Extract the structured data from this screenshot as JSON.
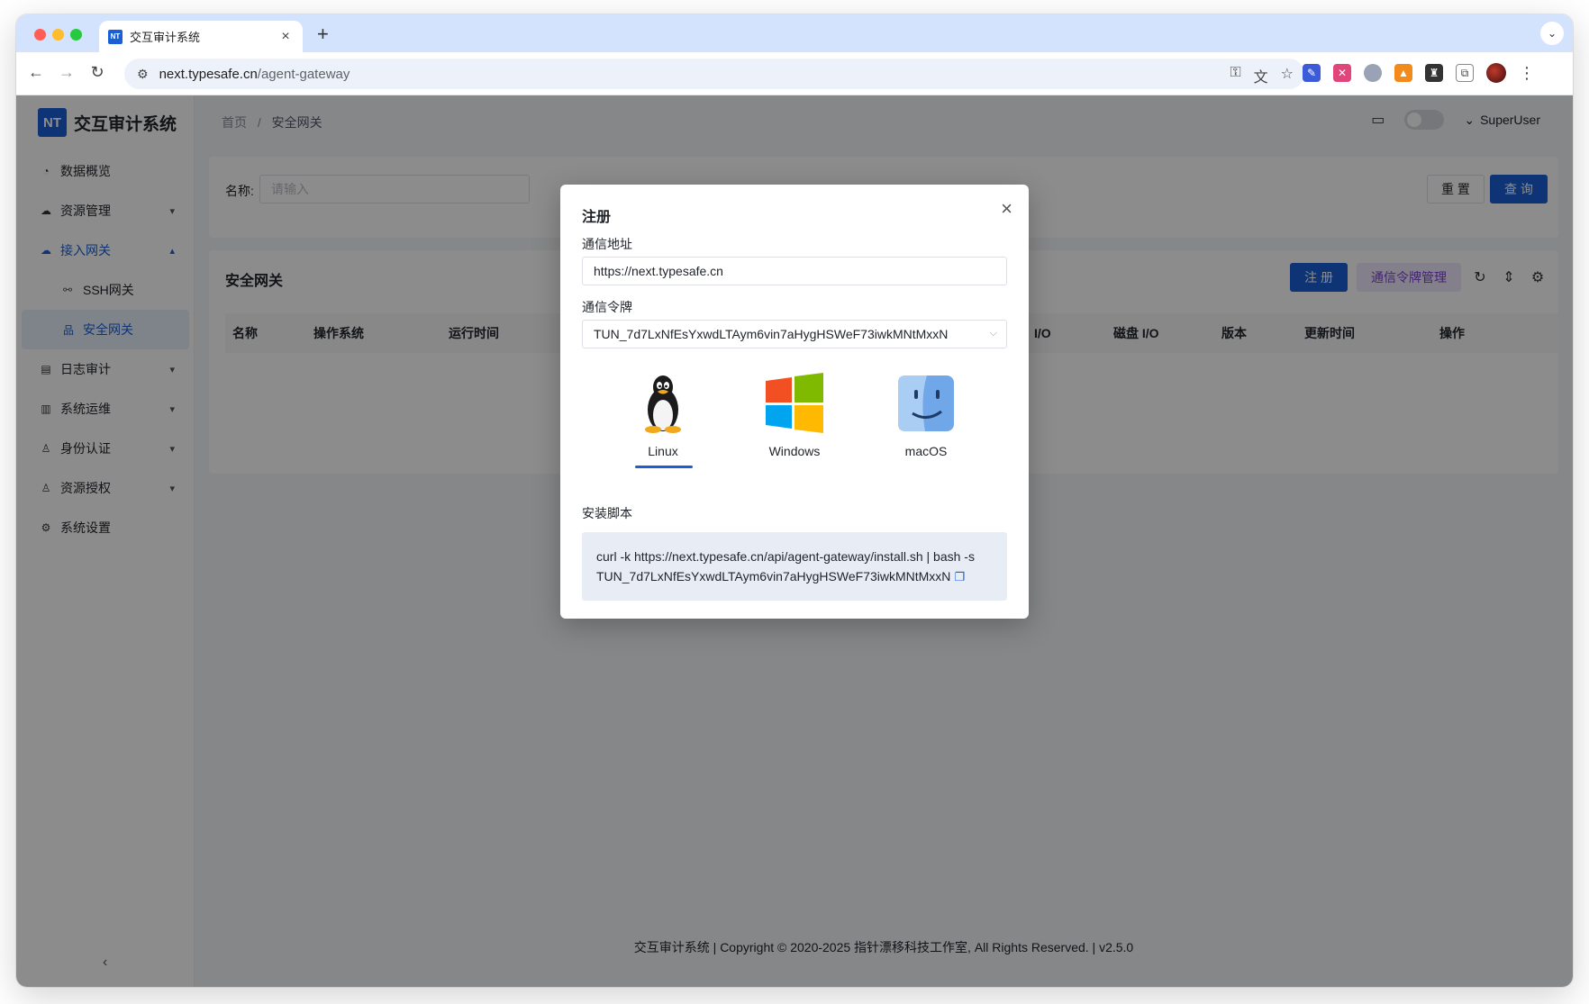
{
  "browser": {
    "tab_title": "交互审计系统",
    "tab_favicon": "NT",
    "url_host": "next.typesafe.cn",
    "url_path": "/agent-gateway"
  },
  "app": {
    "logo_mark": "NT",
    "logo_text": "交互审计系统",
    "menu": {
      "overview": "数据概览",
      "resources": "资源管理",
      "gateway": "接入网关",
      "ssh_gateway": "SSH网关",
      "secure_gateway": "安全网关",
      "log_audit": "日志审计",
      "ops": "系统运维",
      "identity": "身份认证",
      "authorization": "资源授权",
      "settings": "系统设置"
    },
    "breadcrumb": {
      "home": "首页",
      "sep": "/",
      "current": "安全网关"
    },
    "user": "SuperUser",
    "filter": {
      "label": "名称:",
      "placeholder": "请输入",
      "reset": "重 置",
      "query": "查 询"
    },
    "table": {
      "title": "安全网关",
      "register": "注 册",
      "token_mgmt": "通信令牌管理",
      "columns": [
        "名称",
        "操作系统",
        "运行时间",
        "I/O",
        "磁盘 I/O",
        "版本",
        "更新时间",
        "操作"
      ]
    },
    "footer": "交互审计系统 | Copyright © 2020-2025 指针漂移科技工作室, All Rights Reserved. | v2.5.0"
  },
  "modal": {
    "title": "注册",
    "address_label": "通信地址",
    "address_value": "https://next.typesafe.cn",
    "token_label": "通信令牌",
    "token_value": "TUN_7d7LxNfEsYxwdLTAym6vin7aHygHSWeF73iwkMNtMxxN",
    "os_tabs": [
      "Linux",
      "Windows",
      "macOS"
    ],
    "os_selected": "Linux",
    "script_label": "安装脚本",
    "script_text": "curl -k https://next.typesafe.cn/api/agent-gateway/install.sh | bash -s TUN_7d7LxNfEsYxwdLTAym6vin7aHygHSWeF73iwkMNtMxxN"
  },
  "colors": {
    "primary": "#1a5fd6",
    "token_button_bg": "#f1eafd",
    "token_button_text": "#7b3fd6",
    "overlay": "rgba(0,0,0,0.45)"
  }
}
